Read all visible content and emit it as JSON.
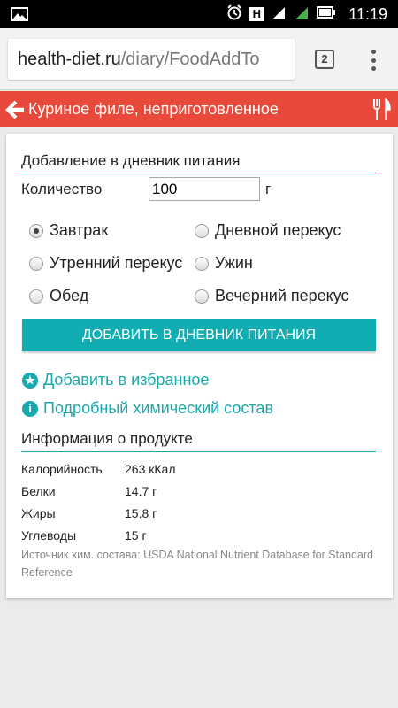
{
  "status_bar": {
    "time": "11:19",
    "h_badge": "H"
  },
  "browser": {
    "url_domain": "health-diet.ru",
    "url_path": "/diary/FoodAddTo",
    "tab_count": "2"
  },
  "header": {
    "title": "Куриное филе, неприготовленное"
  },
  "diary_section": {
    "title": "Добавление в дневник питания",
    "quantity_label": "Количество",
    "quantity_value": "100",
    "unit": "г",
    "meals": [
      {
        "label": "Завтрак",
        "checked": true
      },
      {
        "label": "Дневной перекус",
        "checked": false
      },
      {
        "label": "Утренний перекус",
        "checked": false
      },
      {
        "label": "Ужин",
        "checked": false
      },
      {
        "label": "Обед",
        "checked": false
      },
      {
        "label": "Вечерний перекус",
        "checked": false
      }
    ],
    "add_button": "ДОБАВИТЬ В ДНЕВНИК ПИТАНИЯ"
  },
  "links": {
    "favorite": "Добавить в избранное",
    "composition": "Подробный химический состав"
  },
  "product_info": {
    "title": "Информация о продукте",
    "rows": [
      {
        "key": "Калорийность",
        "value": "263 кКал"
      },
      {
        "key": "Белки",
        "value": "14.7 г"
      },
      {
        "key": "Жиры",
        "value": "15.8 г"
      },
      {
        "key": "Углеводы",
        "value": "15 г"
      }
    ],
    "source": "Источник хим. состава: USDA National Nutrient Database for Standard Reference"
  },
  "colors": {
    "header_red": "#e8493a",
    "accent_teal": "#12adb2",
    "link_teal": "#19a8ad"
  }
}
